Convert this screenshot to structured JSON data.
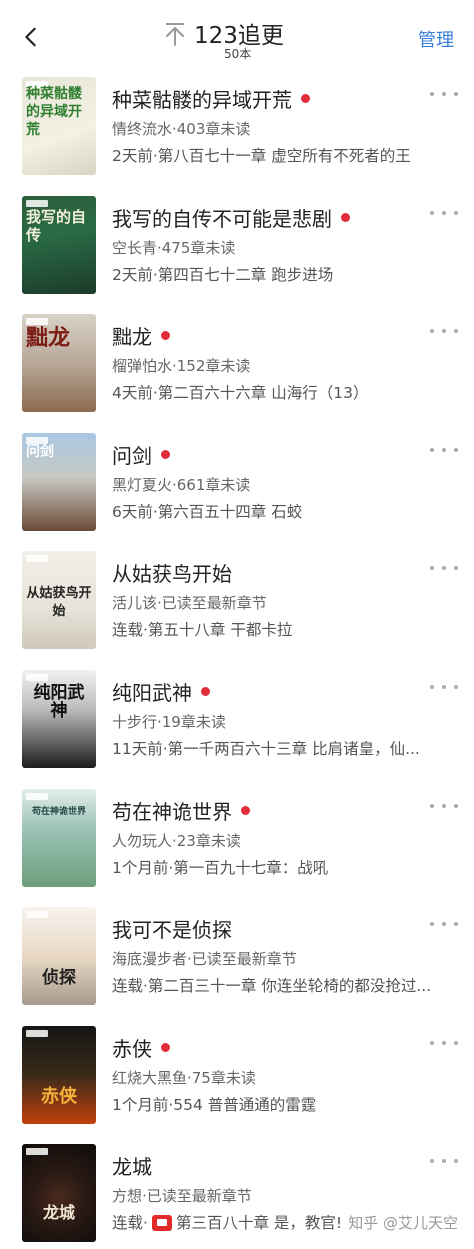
{
  "header": {
    "title": "123追更",
    "count": "50本",
    "manage_label": "管理"
  },
  "icons": {
    "back": "back-chevron-icon",
    "top": "pin-to-top-icon",
    "more": "more-dots-icon",
    "tv": "tv-icon"
  },
  "colors": {
    "accent": "#3a7fd8",
    "unread_dot": "#e12d3a"
  },
  "books": [
    {
      "title": "种菜骷髅的异域开荒",
      "unread": true,
      "author_line": "情终流水·403章未读",
      "chapter_line": "2天前·第八百七十一章 虚空所有不死者的王",
      "cover_text": "种菜骷髅的异域开荒"
    },
    {
      "title": "我写的自传不可能是悲剧",
      "unread": true,
      "author_line": "空长青·475章未读",
      "chapter_line": "2天前·第四百七十二章 跑步进场",
      "cover_text": "我写的自传"
    },
    {
      "title": "黜龙",
      "unread": true,
      "author_line": "榴弹怕水·152章未读",
      "chapter_line": "4天前·第二百六十六章 山海行（13）",
      "cover_text": "黜龙"
    },
    {
      "title": "问剑",
      "unread": true,
      "author_line": "黑灯夏火·661章未读",
      "chapter_line": "6天前·第六百五十四章 石蛟",
      "cover_text": "问剑"
    },
    {
      "title": "从姑获鸟开始",
      "unread": false,
      "author_line": "活儿该·已读至最新章节",
      "chapter_line": "连载·第五十八章 干都卡拉",
      "cover_text": "从姑获鸟开始"
    },
    {
      "title": "纯阳武神",
      "unread": true,
      "author_line": "十步行·19章未读",
      "chapter_line": "11天前·第一千两百六十三章 比肩诸皇，仙...",
      "cover_text": "纯阳武神"
    },
    {
      "title": "苟在神诡世界",
      "unread": true,
      "author_line": "人勿玩人·23章未读",
      "chapter_line": "1个月前·第一百九十七章：战吼",
      "cover_text": "苟在神诡世界"
    },
    {
      "title": "我可不是侦探",
      "unread": false,
      "author_line": "海底漫步者·已读至最新章节",
      "chapter_line": "连载·第二百三十一章 你连坐轮椅的都没抢过...",
      "cover_text": "侦探"
    },
    {
      "title": "赤侠",
      "unread": true,
      "author_line": "红烧大黑鱼·75章未读",
      "chapter_line": "1个月前·554 普普通通的雷霆",
      "cover_text": "赤侠"
    },
    {
      "title": "龙城",
      "unread": false,
      "author_line": "方想·已读至最新章节",
      "chapter_prefix": "连载·",
      "chapter_rest": "第三百八十章 是，教官!",
      "cover_text": "龙城"
    }
  ],
  "watermark": "知乎 @艾儿天空"
}
